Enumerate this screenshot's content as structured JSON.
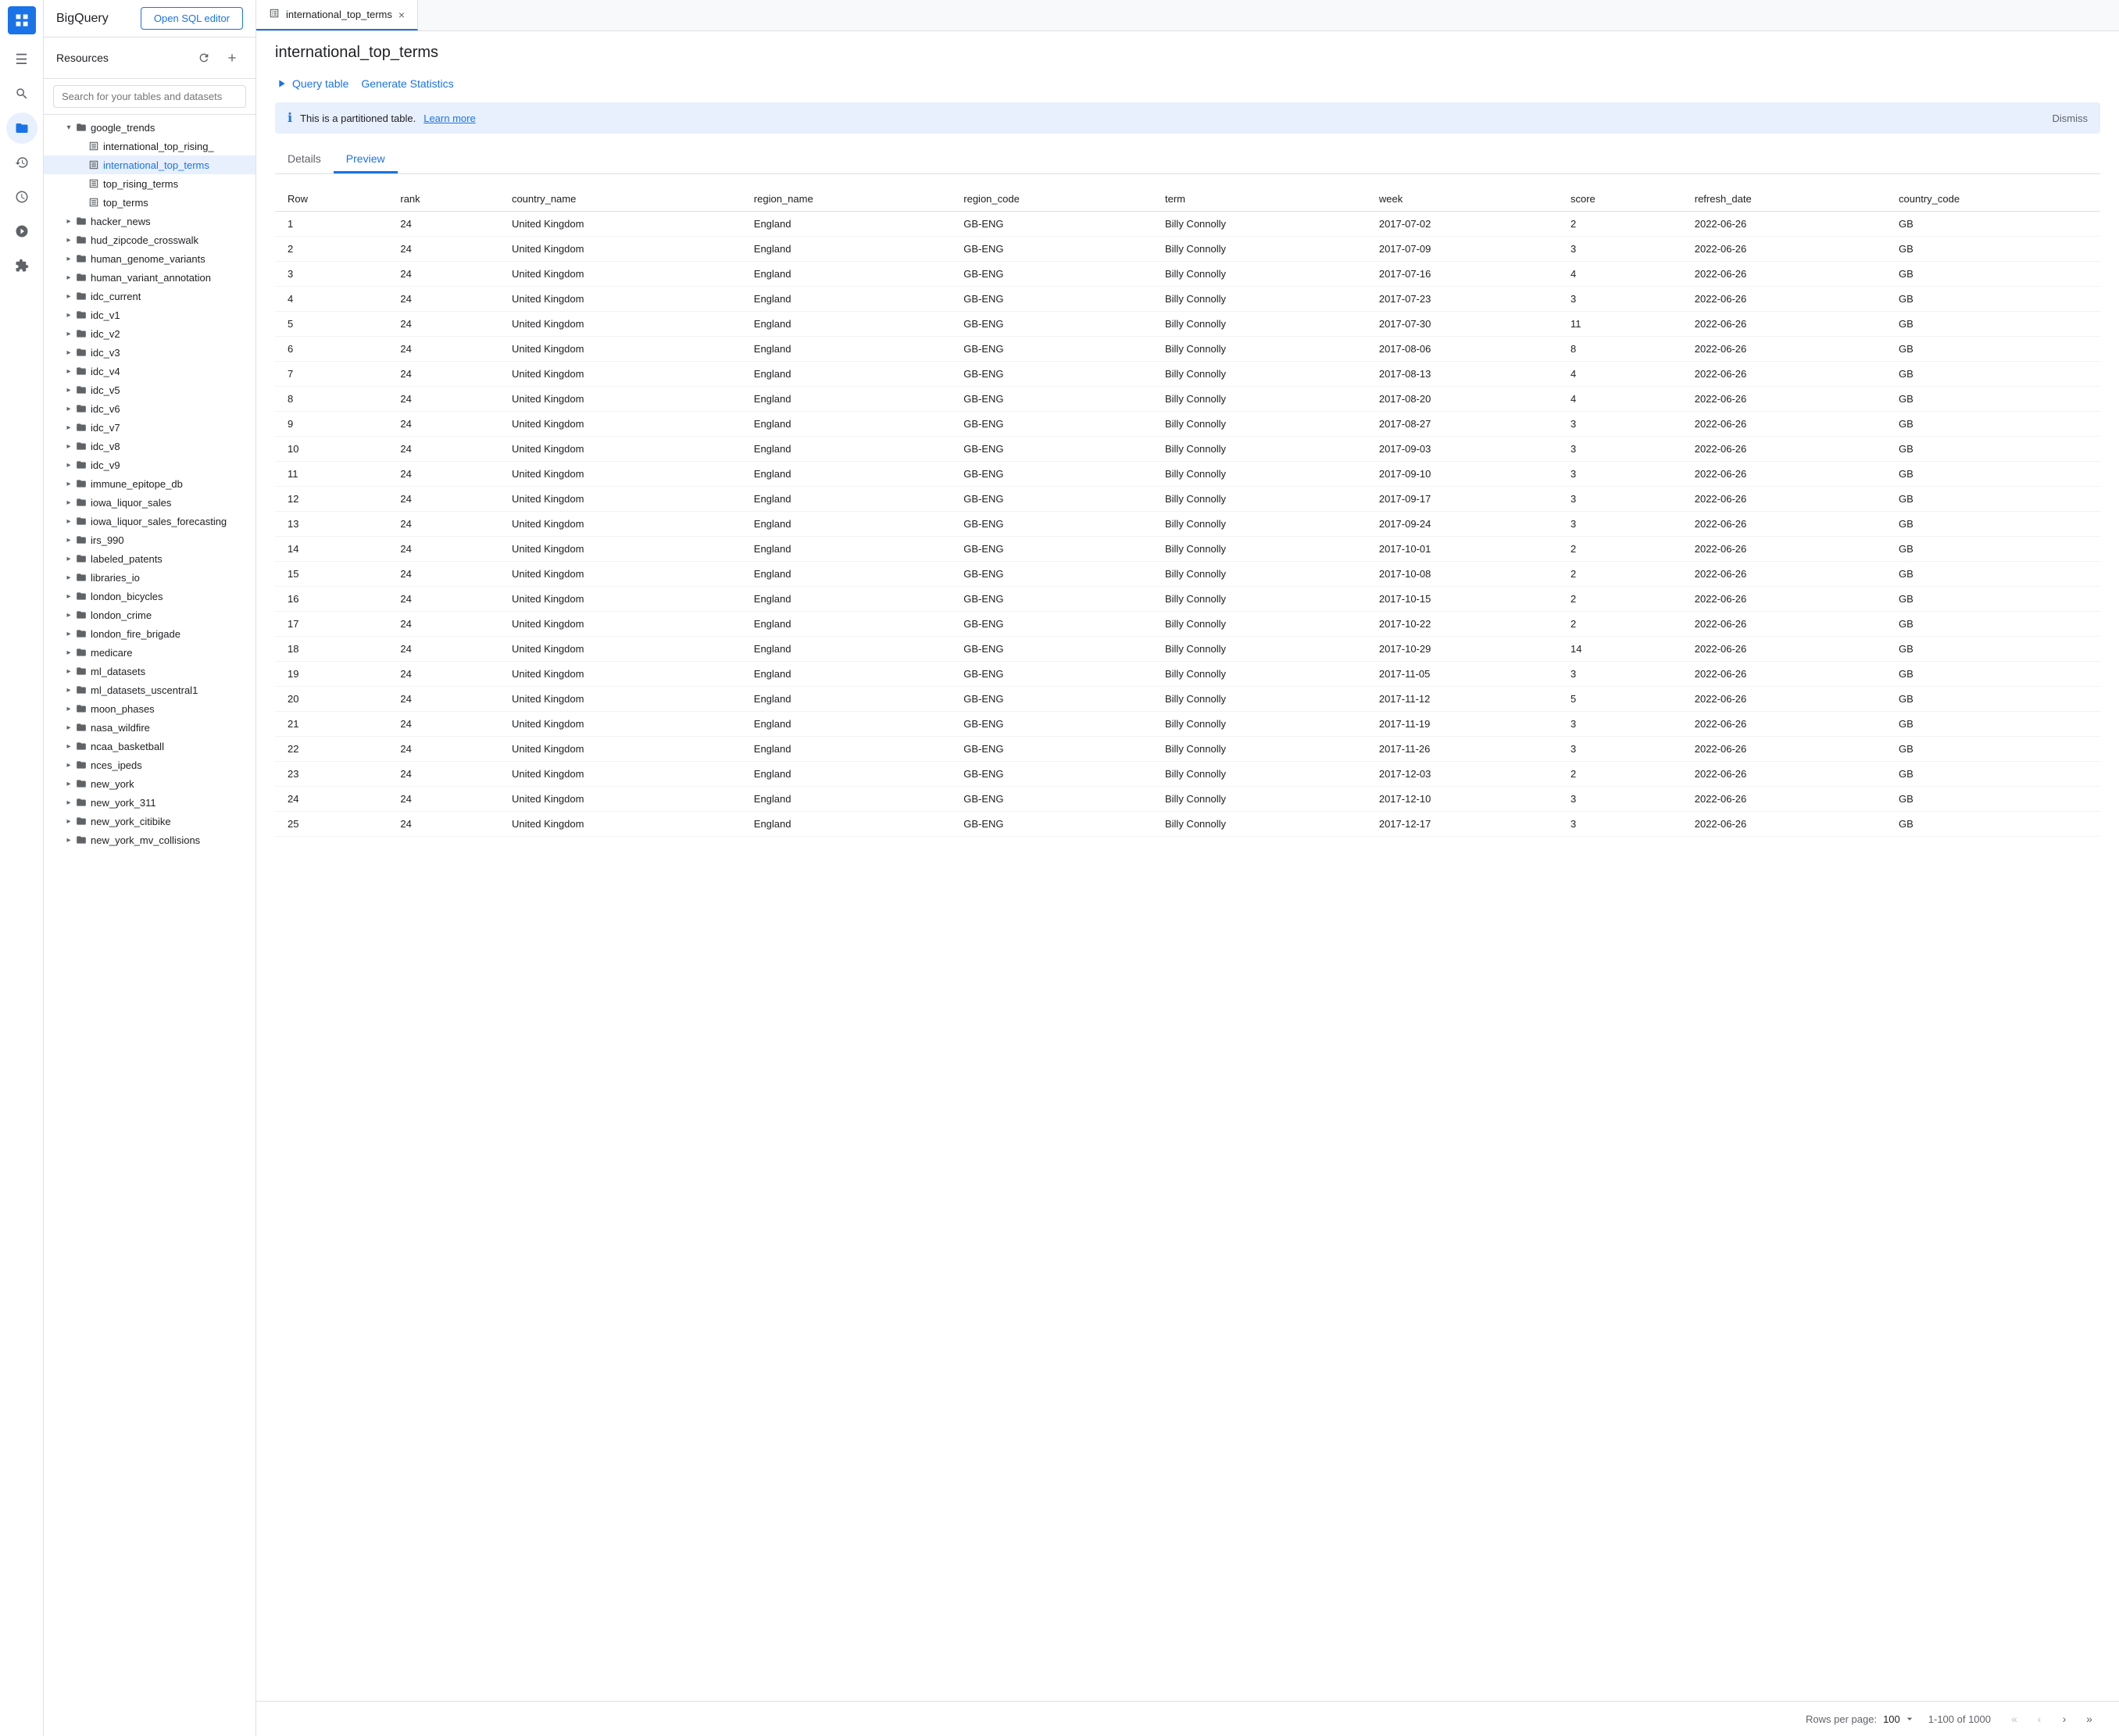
{
  "app": {
    "logo_text": "≡",
    "title": "BigQuery",
    "open_sql_label": "Open SQL editor"
  },
  "sidebar": {
    "title": "Resources",
    "search_placeholder": "Search for your tables and datasets",
    "items": [
      {
        "id": "google_trends",
        "label": "google_trends",
        "level": 1,
        "type": "dataset",
        "expanded": true,
        "has_arrow": true
      },
      {
        "id": "international_top_rising",
        "label": "international_top_rising_",
        "level": 2,
        "type": "table"
      },
      {
        "id": "international_top_terms",
        "label": "international_top_terms",
        "level": 2,
        "type": "table",
        "selected": true
      },
      {
        "id": "top_rising_terms",
        "label": "top_rising_terms",
        "level": 2,
        "type": "table"
      },
      {
        "id": "top_terms",
        "label": "top_terms",
        "level": 2,
        "type": "table"
      },
      {
        "id": "hacker_news",
        "label": "hacker_news",
        "level": 1,
        "type": "dataset",
        "has_arrow": true
      },
      {
        "id": "hud_zipcode_crosswalk",
        "label": "hud_zipcode_crosswalk",
        "level": 1,
        "type": "dataset",
        "has_arrow": true
      },
      {
        "id": "human_genome_variants",
        "label": "human_genome_variants",
        "level": 1,
        "type": "dataset",
        "has_arrow": true
      },
      {
        "id": "human_variant_annotation",
        "label": "human_variant_annotation",
        "level": 1,
        "type": "dataset",
        "has_arrow": true
      },
      {
        "id": "idc_current",
        "label": "idc_current",
        "level": 1,
        "type": "dataset",
        "has_arrow": true
      },
      {
        "id": "idc_v1",
        "label": "idc_v1",
        "level": 1,
        "type": "dataset",
        "has_arrow": true
      },
      {
        "id": "idc_v2",
        "label": "idc_v2",
        "level": 1,
        "type": "dataset",
        "has_arrow": true
      },
      {
        "id": "idc_v3",
        "label": "idc_v3",
        "level": 1,
        "type": "dataset",
        "has_arrow": true
      },
      {
        "id": "idc_v4",
        "label": "idc_v4",
        "level": 1,
        "type": "dataset",
        "has_arrow": true
      },
      {
        "id": "idc_v5",
        "label": "idc_v5",
        "level": 1,
        "type": "dataset",
        "has_arrow": true
      },
      {
        "id": "idc_v6",
        "label": "idc_v6",
        "level": 1,
        "type": "dataset",
        "has_arrow": true
      },
      {
        "id": "idc_v7",
        "label": "idc_v7",
        "level": 1,
        "type": "dataset",
        "has_arrow": true
      },
      {
        "id": "idc_v8",
        "label": "idc_v8",
        "level": 1,
        "type": "dataset",
        "has_arrow": true
      },
      {
        "id": "idc_v9",
        "label": "idc_v9",
        "level": 1,
        "type": "dataset",
        "has_arrow": true
      },
      {
        "id": "immune_epitope_db",
        "label": "immune_epitope_db",
        "level": 1,
        "type": "dataset",
        "has_arrow": true
      },
      {
        "id": "iowa_liquor_sales",
        "label": "iowa_liquor_sales",
        "level": 1,
        "type": "dataset",
        "has_arrow": true
      },
      {
        "id": "iowa_liquor_sales_forecasting",
        "label": "iowa_liquor_sales_forecasting",
        "level": 1,
        "type": "dataset",
        "has_arrow": true
      },
      {
        "id": "irs_990",
        "label": "irs_990",
        "level": 1,
        "type": "dataset",
        "has_arrow": true
      },
      {
        "id": "labeled_patents",
        "label": "labeled_patents",
        "level": 1,
        "type": "dataset",
        "has_arrow": true
      },
      {
        "id": "libraries_io",
        "label": "libraries_io",
        "level": 1,
        "type": "dataset",
        "has_arrow": true
      },
      {
        "id": "london_bicycles",
        "label": "london_bicycles",
        "level": 1,
        "type": "dataset",
        "has_arrow": true
      },
      {
        "id": "london_crime",
        "label": "london_crime",
        "level": 1,
        "type": "dataset",
        "has_arrow": true
      },
      {
        "id": "london_fire_brigade",
        "label": "london_fire_brigade",
        "level": 1,
        "type": "dataset",
        "has_arrow": true
      },
      {
        "id": "medicare",
        "label": "medicare",
        "level": 1,
        "type": "dataset",
        "has_arrow": true
      },
      {
        "id": "ml_datasets",
        "label": "ml_datasets",
        "level": 1,
        "type": "dataset",
        "has_arrow": true
      },
      {
        "id": "ml_datasets_uscentral1",
        "label": "ml_datasets_uscentral1",
        "level": 1,
        "type": "dataset",
        "has_arrow": true
      },
      {
        "id": "moon_phases",
        "label": "moon_phases",
        "level": 1,
        "type": "dataset",
        "has_arrow": true
      },
      {
        "id": "nasa_wildfire",
        "label": "nasa_wildfire",
        "level": 1,
        "type": "dataset",
        "has_arrow": true
      },
      {
        "id": "ncaa_basketball",
        "label": "ncaa_basketball",
        "level": 1,
        "type": "dataset",
        "has_arrow": true
      },
      {
        "id": "nces_ipeds",
        "label": "nces_ipeds",
        "level": 1,
        "type": "dataset",
        "has_arrow": true
      },
      {
        "id": "new_york",
        "label": "new_york",
        "level": 1,
        "type": "dataset",
        "has_arrow": true
      },
      {
        "id": "new_york_311",
        "label": "new_york_311",
        "level": 1,
        "type": "dataset",
        "has_arrow": true
      },
      {
        "id": "new_york_citibike",
        "label": "new_york_citibike",
        "level": 1,
        "type": "dataset",
        "has_arrow": true
      },
      {
        "id": "new_york_mv_collisions",
        "label": "new_york_mv_collisions",
        "level": 1,
        "type": "dataset",
        "has_arrow": true
      }
    ]
  },
  "tab": {
    "label": "international_top_terms",
    "close_label": "×"
  },
  "page": {
    "title": "international_top_terms",
    "query_table_label": "Query table",
    "generate_statistics_label": "Generate Statistics",
    "info_text": "This is a partitioned table.",
    "learn_more_label": "Learn more",
    "dismiss_label": "Dismiss",
    "details_tab": "Details",
    "preview_tab": "Preview"
  },
  "table": {
    "columns": [
      "Row",
      "rank",
      "country_name",
      "region_name",
      "region_code",
      "term",
      "week",
      "score",
      "refresh_date",
      "country_code"
    ],
    "rows": [
      [
        1,
        24,
        "United Kingdom",
        "England",
        "GB-ENG",
        "Billy Connolly",
        "2017-07-02",
        2,
        "2022-06-26",
        "GB"
      ],
      [
        2,
        24,
        "United Kingdom",
        "England",
        "GB-ENG",
        "Billy Connolly",
        "2017-07-09",
        3,
        "2022-06-26",
        "GB"
      ],
      [
        3,
        24,
        "United Kingdom",
        "England",
        "GB-ENG",
        "Billy Connolly",
        "2017-07-16",
        4,
        "2022-06-26",
        "GB"
      ],
      [
        4,
        24,
        "United Kingdom",
        "England",
        "GB-ENG",
        "Billy Connolly",
        "2017-07-23",
        3,
        "2022-06-26",
        "GB"
      ],
      [
        5,
        24,
        "United Kingdom",
        "England",
        "GB-ENG",
        "Billy Connolly",
        "2017-07-30",
        11,
        "2022-06-26",
        "GB"
      ],
      [
        6,
        24,
        "United Kingdom",
        "England",
        "GB-ENG",
        "Billy Connolly",
        "2017-08-06",
        8,
        "2022-06-26",
        "GB"
      ],
      [
        7,
        24,
        "United Kingdom",
        "England",
        "GB-ENG",
        "Billy Connolly",
        "2017-08-13",
        4,
        "2022-06-26",
        "GB"
      ],
      [
        8,
        24,
        "United Kingdom",
        "England",
        "GB-ENG",
        "Billy Connolly",
        "2017-08-20",
        4,
        "2022-06-26",
        "GB"
      ],
      [
        9,
        24,
        "United Kingdom",
        "England",
        "GB-ENG",
        "Billy Connolly",
        "2017-08-27",
        3,
        "2022-06-26",
        "GB"
      ],
      [
        10,
        24,
        "United Kingdom",
        "England",
        "GB-ENG",
        "Billy Connolly",
        "2017-09-03",
        3,
        "2022-06-26",
        "GB"
      ],
      [
        11,
        24,
        "United Kingdom",
        "England",
        "GB-ENG",
        "Billy Connolly",
        "2017-09-10",
        3,
        "2022-06-26",
        "GB"
      ],
      [
        12,
        24,
        "United Kingdom",
        "England",
        "GB-ENG",
        "Billy Connolly",
        "2017-09-17",
        3,
        "2022-06-26",
        "GB"
      ],
      [
        13,
        24,
        "United Kingdom",
        "England",
        "GB-ENG",
        "Billy Connolly",
        "2017-09-24",
        3,
        "2022-06-26",
        "GB"
      ],
      [
        14,
        24,
        "United Kingdom",
        "England",
        "GB-ENG",
        "Billy Connolly",
        "2017-10-01",
        2,
        "2022-06-26",
        "GB"
      ],
      [
        15,
        24,
        "United Kingdom",
        "England",
        "GB-ENG",
        "Billy Connolly",
        "2017-10-08",
        2,
        "2022-06-26",
        "GB"
      ],
      [
        16,
        24,
        "United Kingdom",
        "England",
        "GB-ENG",
        "Billy Connolly",
        "2017-10-15",
        2,
        "2022-06-26",
        "GB"
      ],
      [
        17,
        24,
        "United Kingdom",
        "England",
        "GB-ENG",
        "Billy Connolly",
        "2017-10-22",
        2,
        "2022-06-26",
        "GB"
      ],
      [
        18,
        24,
        "United Kingdom",
        "England",
        "GB-ENG",
        "Billy Connolly",
        "2017-10-29",
        14,
        "2022-06-26",
        "GB"
      ],
      [
        19,
        24,
        "United Kingdom",
        "England",
        "GB-ENG",
        "Billy Connolly",
        "2017-11-05",
        3,
        "2022-06-26",
        "GB"
      ],
      [
        20,
        24,
        "United Kingdom",
        "England",
        "GB-ENG",
        "Billy Connolly",
        "2017-11-12",
        5,
        "2022-06-26",
        "GB"
      ],
      [
        21,
        24,
        "United Kingdom",
        "England",
        "GB-ENG",
        "Billy Connolly",
        "2017-11-19",
        3,
        "2022-06-26",
        "GB"
      ],
      [
        22,
        24,
        "United Kingdom",
        "England",
        "GB-ENG",
        "Billy Connolly",
        "2017-11-26",
        3,
        "2022-06-26",
        "GB"
      ],
      [
        23,
        24,
        "United Kingdom",
        "England",
        "GB-ENG",
        "Billy Connolly",
        "2017-12-03",
        2,
        "2022-06-26",
        "GB"
      ],
      [
        24,
        24,
        "United Kingdom",
        "England",
        "GB-ENG",
        "Billy Connolly",
        "2017-12-10",
        3,
        "2022-06-26",
        "GB"
      ],
      [
        25,
        24,
        "United Kingdom",
        "England",
        "GB-ENG",
        "Billy Connolly",
        "2017-12-17",
        3,
        "2022-06-26",
        "GB"
      ]
    ]
  },
  "footer": {
    "rows_per_page_label": "Rows per page:",
    "rows_per_page_value": "100",
    "rows_count": "1-100 of 1000",
    "first_page_label": "«",
    "prev_page_label": "‹",
    "next_page_label": "›",
    "last_page_label": "»"
  },
  "left_nav": {
    "icons": [
      {
        "name": "menu-icon",
        "symbol": "☰"
      },
      {
        "name": "search-icon",
        "symbol": "🔍"
      },
      {
        "name": "pin-icon",
        "symbol": "📌"
      },
      {
        "name": "history-icon",
        "symbol": "⏱"
      },
      {
        "name": "list-icon",
        "symbol": "☰"
      },
      {
        "name": "calendar-icon",
        "symbol": "📅"
      },
      {
        "name": "puzzle-icon",
        "symbol": "🧩"
      }
    ]
  }
}
